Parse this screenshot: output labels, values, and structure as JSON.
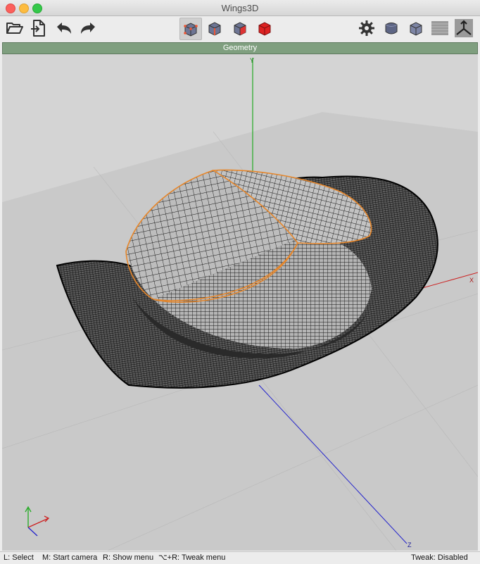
{
  "window": {
    "title": "Wings3D"
  },
  "toolbar": {
    "left_icons": [
      "open-folder-icon",
      "save-file-icon",
      "undo-icon",
      "redo-icon"
    ],
    "select_mode_icons": [
      "vertex-select-icon",
      "edge-select-icon",
      "face-select-icon",
      "body-select-icon"
    ],
    "right_icons": [
      "gear-icon",
      "smooth-preview-icon",
      "wireframe-cube-icon",
      "ground-plane-icon",
      "axes-icon"
    ]
  },
  "viewport": {
    "title": "Geometry",
    "axes": {
      "y_label": "Y",
      "x_label": "X",
      "z_label": "Z"
    }
  },
  "status": {
    "select": "L: Select",
    "camera": "M: Start camera",
    "menu": "R: Show menu",
    "tweak_menu": "⌥+R: Tweak menu",
    "tweak_state": "Tweak: Disabled"
  },
  "colors": {
    "geometry_bar": "#7f9f7f",
    "selection_edge": "#e6862a",
    "axis_x": "#cc2222",
    "axis_y": "#22aa22",
    "axis_z": "#2222cc"
  }
}
